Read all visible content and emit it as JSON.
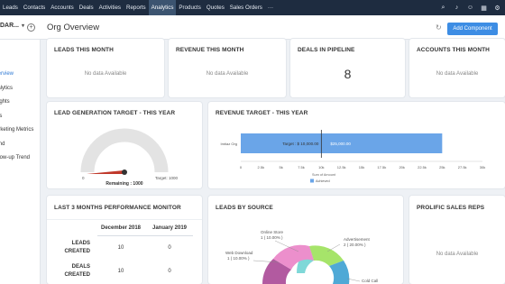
{
  "nav": {
    "items": [
      "Leads",
      "Contacts",
      "Accounts",
      "Deals",
      "Activities",
      "Reports",
      "Analytics",
      "Products",
      "Quotes",
      "Sales Orders",
      "···"
    ],
    "active_index": 6,
    "icons": [
      "search-icon",
      "bell-icon",
      "user-icon",
      "calendar-icon",
      "settings-icon"
    ]
  },
  "header": {
    "dashboard_select": "DAR...",
    "page_title": "Org Overview",
    "add_component_label": "Add Component"
  },
  "sidebar": {
    "items": [
      "Overview",
      "Analytics",
      "Insights",
      "Lists",
      "Marketing Metrics",
      "Trend",
      "Follow-up Trend"
    ],
    "active_index": 0
  },
  "kpi_cards": [
    {
      "title": "LEADS THIS MONTH",
      "value": "No data Available",
      "is_empty": true
    },
    {
      "title": "REVENUE THIS MONTH",
      "value": "No data Available",
      "is_empty": true
    },
    {
      "title": "DEALS IN PIPELINE",
      "value": "8",
      "is_empty": false
    },
    {
      "title": "ACCOUNTS THIS MONTH",
      "value": "No data Available",
      "is_empty": true
    }
  ],
  "lead_gen": {
    "title": "LEAD GENERATION TARGET - THIS YEAR",
    "min_label": "0",
    "max_label": "Target: 1000",
    "remaining_label": "Remaining : 1000",
    "achieved": 0,
    "target": 1000,
    "track_color": "#e3e3e3",
    "needle_color": "#c0392b"
  },
  "revenue_target": {
    "title": "REVENUE TARGET - THIS YEAR",
    "category": "Imtiaz Org",
    "target_label": "Target : $ 10,000.00",
    "achieved_label": "$25,000.00",
    "achieved": 25000,
    "target": 10000,
    "xticks": [
      "0",
      "2.5k",
      "5k",
      "7.5k",
      "10k",
      "12.5k",
      "15k",
      "17.5k",
      "20k",
      "22.5k",
      "25k",
      "27.5k",
      "30k"
    ],
    "xmax": 30000,
    "xlabel": "Sum of Amount",
    "legend": "Achieved",
    "bar_color": "#6aa5e8"
  },
  "perf_monitor": {
    "title": "LAST 3 MONTHS PERFORMANCE MONITOR",
    "columns": [
      "December 2018",
      "January 2019"
    ],
    "rows": [
      {
        "label": [
          "LEADS",
          "CREATED"
        ],
        "values": [
          "10",
          "0"
        ]
      },
      {
        "label": [
          "DEALS",
          "CREATED"
        ],
        "values": [
          "10",
          "0"
        ]
      }
    ]
  },
  "leads_by_source": {
    "title": "LEADS BY SOURCE",
    "labels": [
      {
        "text": "Online Store",
        "sub": "1 ( 10.00% )"
      },
      {
        "text": "Advertisement",
        "sub": "2 ( 20.00% )"
      },
      {
        "text": "Web Download",
        "sub": "1 ( 10.00% )"
      },
      {
        "text": "Cold Call",
        "sub": ""
      }
    ],
    "slice_colors": [
      "#7fd8d8",
      "#a6e46a",
      "#b25aa0",
      "#ec8fcc",
      "#4fa9d6"
    ]
  },
  "prolific": {
    "title": "PROLIFIC SALES REPS",
    "value": "No data Available"
  }
}
